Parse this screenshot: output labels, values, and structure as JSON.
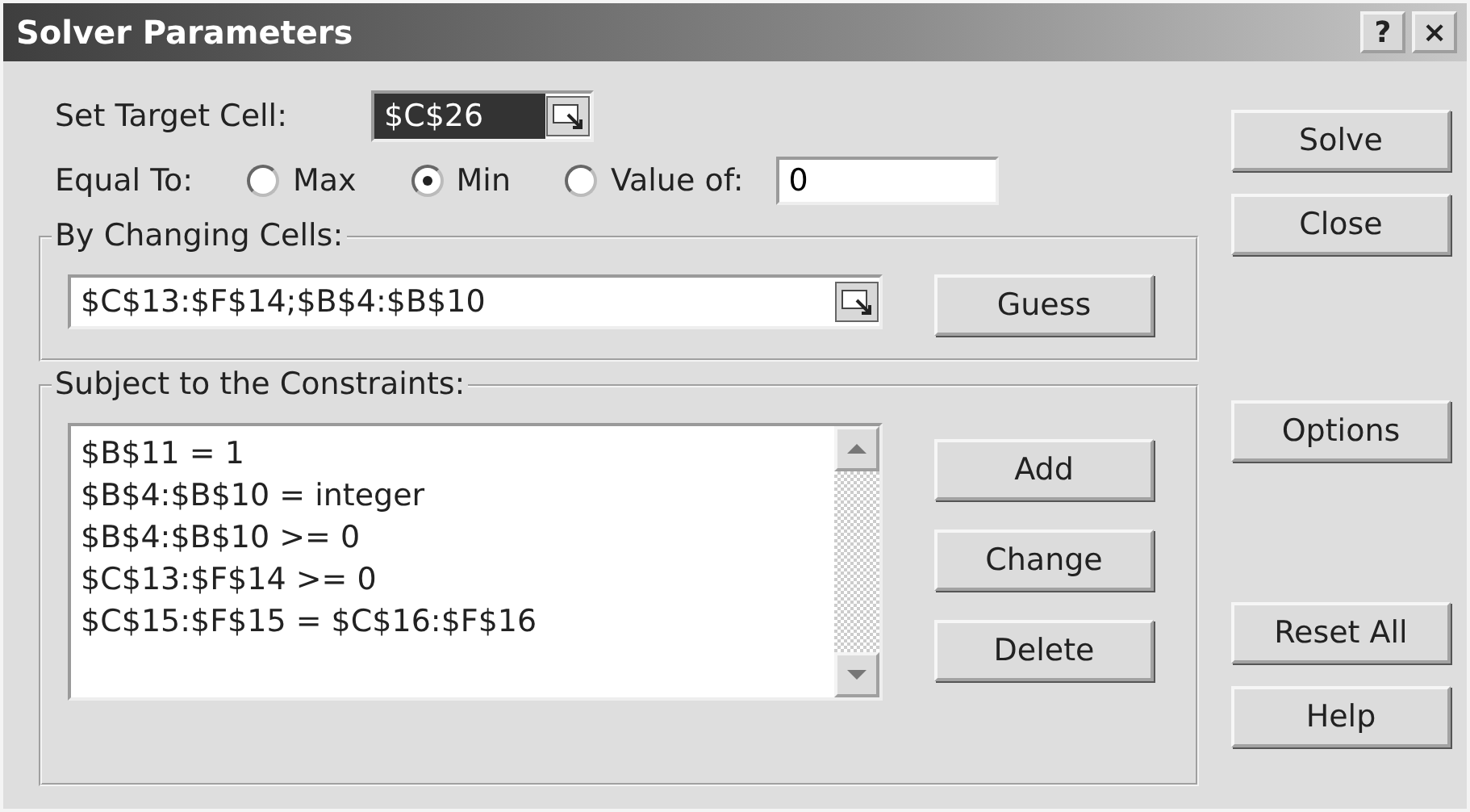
{
  "window": {
    "title": "Solver Parameters",
    "help_button": "?",
    "close_button": "×"
  },
  "target": {
    "label": "Set Target Cell:",
    "value": "$C$26"
  },
  "equal_to": {
    "label": "Equal To:",
    "options": [
      {
        "label": "Max",
        "selected": false
      },
      {
        "label": "Min",
        "selected": true
      },
      {
        "label": "Value of:",
        "selected": false
      }
    ],
    "value": "0"
  },
  "changing_cells": {
    "label": "By Changing Cells:",
    "value": "$C$13:$F$14;$B$4:$B$10",
    "button": {
      "label": "Guess"
    }
  },
  "constraints": {
    "label": "Subject to the Constraints:",
    "items": [
      "$B$11 = 1",
      "$B$4:$B$10 = integer",
      "$B$4:$B$10 >= 0",
      "$C$13:$F$14 >= 0",
      "$C$15:$F$15 = $C$16:$F$16"
    ],
    "buttons": [
      {
        "label": "Add"
      },
      {
        "label": "Change"
      },
      {
        "label": "Delete"
      }
    ]
  },
  "side_buttons": [
    {
      "label": "Solve"
    },
    {
      "label": "Close"
    },
    {
      "label": "Options"
    },
    {
      "label": "Reset All"
    },
    {
      "label": "Help"
    }
  ]
}
